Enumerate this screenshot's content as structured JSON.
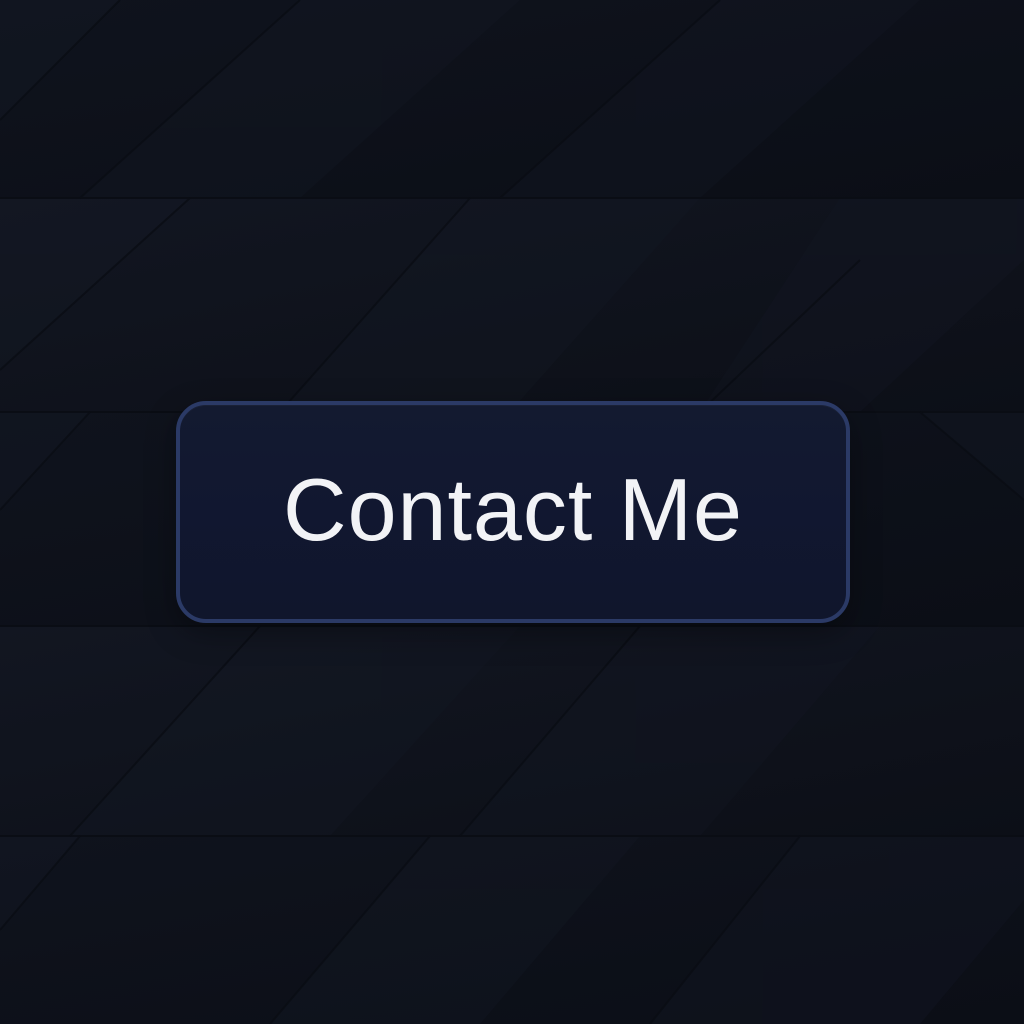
{
  "page": {
    "background_color": "#0e111a"
  },
  "cta": {
    "label": "Contact Me",
    "border_color": "#2b3a66",
    "fill_color": "#121830",
    "text_color": "#f2f3f6"
  }
}
